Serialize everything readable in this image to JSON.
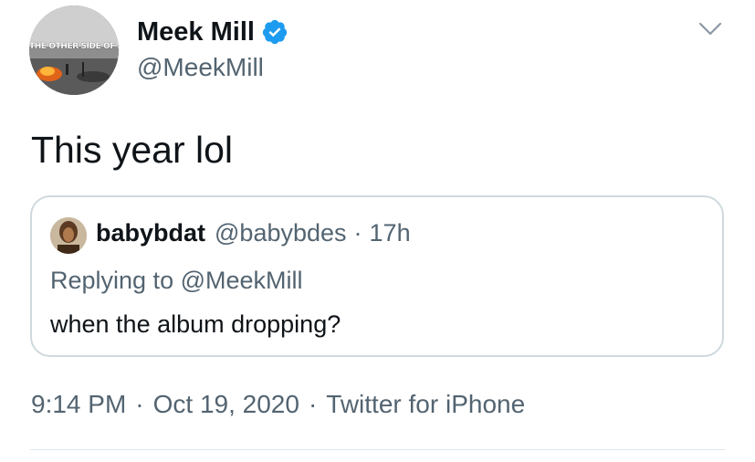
{
  "author": {
    "display_name": "Meek Mill",
    "handle": "@MeekMill",
    "avatar_text": "THE OTHER SIDE OF AMERICA",
    "verified": true
  },
  "tweet": {
    "text": "This year lol"
  },
  "quote": {
    "display_name": "babybdat",
    "handle": "@babybdes",
    "separator": "·",
    "time": "17h",
    "replying_to": "Replying to @MeekMill",
    "text": "when the album dropping?"
  },
  "meta": {
    "time": "9:14 PM",
    "separator": "·",
    "date": "Oct 19, 2020",
    "source": "Twitter for iPhone"
  },
  "icons": {
    "verified": "verified-badge-icon",
    "menu": "chevron-down-icon"
  },
  "colors": {
    "verified_blue": "#1d9bf0",
    "text_primary": "#0f1419",
    "text_secondary": "#536471",
    "border": "#cfd9de"
  }
}
